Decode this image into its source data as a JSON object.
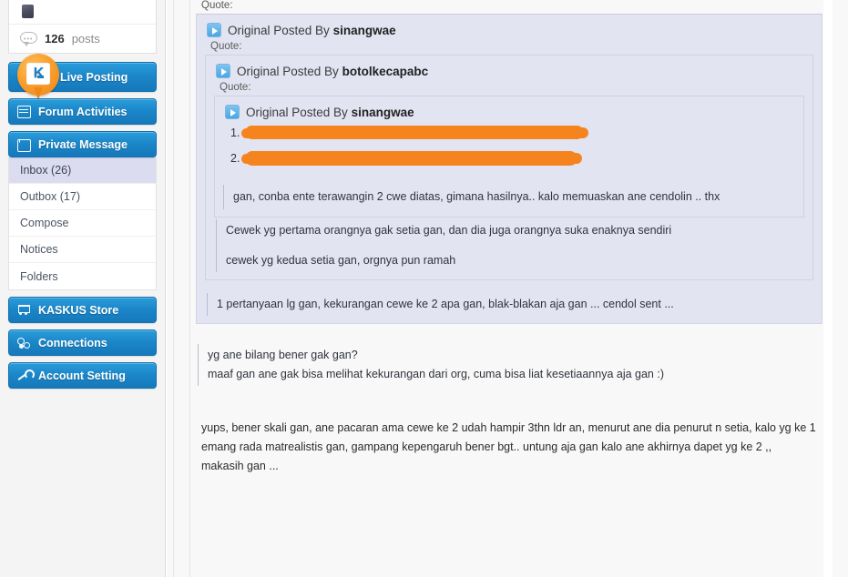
{
  "sidebar": {
    "profile": {
      "posts_count": "126",
      "posts_label": "posts"
    },
    "buttons": [
      {
        "label": "Live Posting",
        "icon": "kaskus-pin-icon"
      },
      {
        "label": "Forum Activities",
        "icon": "calendar-icon"
      },
      {
        "label": "Private Message",
        "icon": "envelope-icon"
      }
    ],
    "submenu": [
      {
        "label": "Inbox (26)",
        "active": true
      },
      {
        "label": "Outbox (17)",
        "active": false
      },
      {
        "label": "Compose",
        "active": false
      },
      {
        "label": "Notices",
        "active": false
      },
      {
        "label": "Folders",
        "active": false
      }
    ],
    "buttons_bottom": [
      {
        "label": "KASKUS Store",
        "icon": "cart-icon"
      },
      {
        "label": "Connections",
        "icon": "connections-icon"
      },
      {
        "label": "Account Setting",
        "icon": "wrench-icon"
      }
    ]
  },
  "content": {
    "quote_label": "Quote:",
    "quote_prefix": "Original Posted By",
    "level1": {
      "author": "sinangwae"
    },
    "level2": {
      "author": "botolkecapabc"
    },
    "level3": {
      "author": "sinangwae",
      "list": [
        {
          "num": "1.",
          "value": ""
        },
        {
          "num": "2.",
          "value": ""
        }
      ],
      "body": "gan, conba ente terawangin 2 cwe diatas, gimana hasilnya.. kalo memuaskan ane cendolin .. thx"
    },
    "level2_body": [
      "Cewek yg pertama orangnya gak setia gan, dan dia juga orangnya suka enaknya sendiri",
      "cewek yg kedua setia gan, orgnya pun ramah"
    ],
    "level1_body": "1 pertanyaan lg gan, kekurangan cewe ke 2 apa gan, blak-blakan aja gan ... cendol sent ...",
    "outer_body": [
      "yg ane bilang bener gak gan?",
      "maaf gan ane gak bisa melihat kekurangan dari org, cuma bisa liat kesetiaannya aja gan :)"
    ],
    "post_body": "yups, bener skali gan, ane pacaran ama cewe ke 2 udah hampir 3thn ldr an, menurut ane dia penurut n setia, kalo yg ke 1 emang rada matrealistis gan, gampang kepengaruh bener bgt.. untung aja gan kalo ane akhirnya dapet yg ke 2 ,, makasih gan ..."
  },
  "colors": {
    "accent_blue": "#1b86c8",
    "quote_bg": "#e2e4f2",
    "redaction_orange": "#f5841f",
    "active_submenu": "#dcdcf0",
    "sidebar_bg": "#f4f4f4"
  }
}
